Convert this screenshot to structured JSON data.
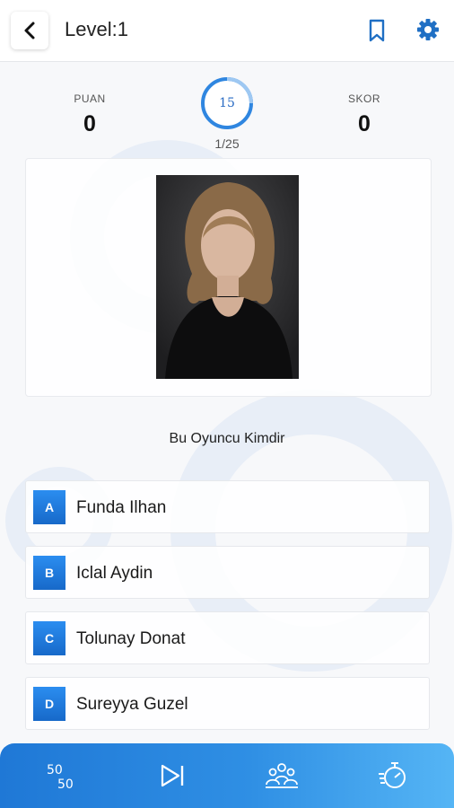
{
  "header": {
    "title": "Level:1",
    "back_icon": "chevron-left-icon",
    "bookmark_icon": "bookmark-icon",
    "settings_icon": "gear-icon",
    "accent_color": "#1f6fc4"
  },
  "stats": {
    "puan_label": "PUAN",
    "puan_value": "0",
    "skor_label": "SKOR",
    "skor_value": "0"
  },
  "timer": {
    "seconds": "15",
    "progress": "1/25"
  },
  "question": {
    "text": "Bu Oyuncu Kimdir"
  },
  "answers": [
    {
      "letter": "A",
      "text": "Funda Ilhan"
    },
    {
      "letter": "B",
      "text": "Iclal Aydin"
    },
    {
      "letter": "C",
      "text": "Tolunay Donat"
    },
    {
      "letter": "D",
      "text": "Sureyya Guzel"
    }
  ],
  "bottom_bar": {
    "items": [
      {
        "icon": "fifty-fifty-icon",
        "label": "50/50"
      },
      {
        "icon": "skip-icon"
      },
      {
        "icon": "audience-icon"
      },
      {
        "icon": "stopwatch-icon"
      }
    ]
  }
}
